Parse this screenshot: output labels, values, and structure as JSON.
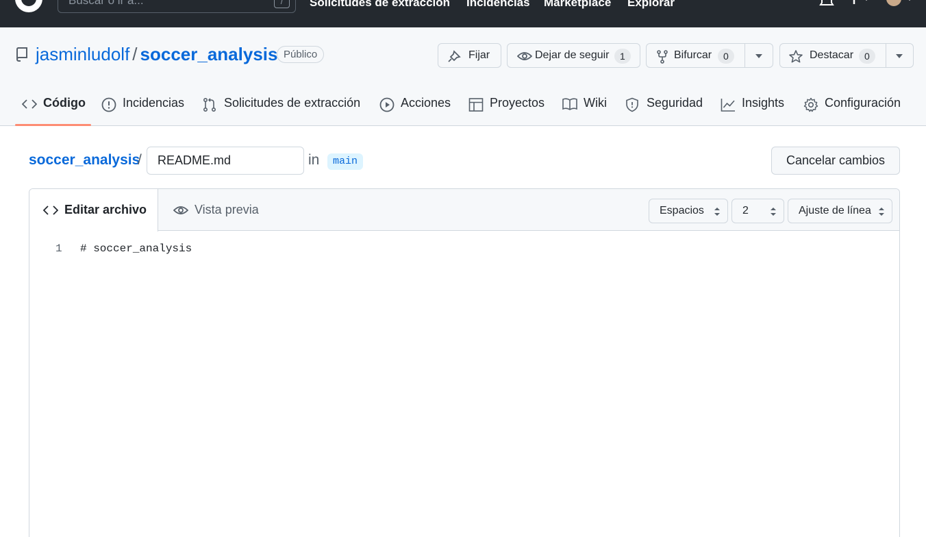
{
  "global_header": {
    "search_placeholder": "Buscar o ir a...",
    "search_shortcut": "/",
    "nav": [
      "Solicitudes de extracción",
      "Incidencias",
      "Marketplace",
      "Explorar"
    ]
  },
  "repo": {
    "owner": "jasminludolf",
    "separator": "/",
    "name": "soccer_analysis",
    "visibility": "Público"
  },
  "actions": {
    "pin_label": "Fijar",
    "watch_label": "Dejar de seguir",
    "watch_count": "1",
    "fork_label": "Bifurcar",
    "fork_count": "0",
    "star_label": "Destacar",
    "star_count": "0"
  },
  "tabs": [
    {
      "label": "Código",
      "icon": "code-icon",
      "active": true
    },
    {
      "label": "Incidencias",
      "icon": "issue-icon"
    },
    {
      "label": "Solicitudes de extracción",
      "icon": "pull-request-icon"
    },
    {
      "label": "Acciones",
      "icon": "play-icon"
    },
    {
      "label": "Proyectos",
      "icon": "table-icon"
    },
    {
      "label": "Wiki",
      "icon": "book-icon"
    },
    {
      "label": "Seguridad",
      "icon": "shield-icon"
    },
    {
      "label": "Insights",
      "icon": "graph-icon"
    },
    {
      "label": "Configuración",
      "icon": "gear-icon"
    }
  ],
  "editor": {
    "breadcrumb_repo": "soccer_analysis",
    "breadcrumb_sep": "/",
    "filename": "README.md",
    "in_word": "in",
    "branch": "main",
    "cancel_label": "Cancelar cambios",
    "edit_tab": "Editar archivo",
    "preview_tab": "Vista previa",
    "indent_mode": "Espacios",
    "indent_size": "2",
    "wrap_mode": "Ajuste de línea",
    "lines": [
      {
        "number": "1",
        "text": "# soccer_analysis"
      }
    ]
  },
  "colors": {
    "link": "#0969da",
    "header_bg": "#24292f",
    "tab_underline": "#fd8c73",
    "branch_bg": "#ddf4ff"
  }
}
